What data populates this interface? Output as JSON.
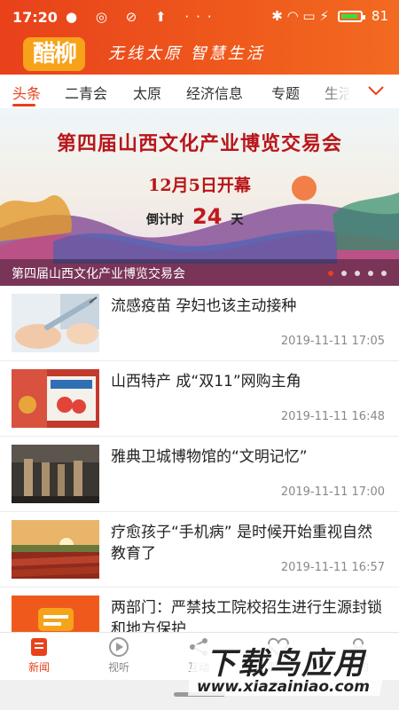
{
  "status_bar": {
    "time": "17:20",
    "left_icons": "● ◎ ⊘ ⬆ ···",
    "right_icons": "✱ ◠ ▭ ⚡",
    "battery": "81"
  },
  "header": {
    "logo": "醋柳",
    "slogan": "无线太原   智慧生活"
  },
  "tabs": [
    {
      "label": "头条",
      "active": true
    },
    {
      "label": "二青会"
    },
    {
      "label": "太原"
    },
    {
      "label": "经济信息"
    },
    {
      "label": "专题"
    },
    {
      "label": "生活"
    }
  ],
  "banner": {
    "title": "第四届山西文化产业博览交易会",
    "date": "12月5日开幕",
    "countdown_prefix": "倒计时",
    "countdown_value": "24",
    "countdown_unit": "天",
    "caption": "第四届山西文化产业博览交易会",
    "slide_count": 5,
    "active_slide": 1
  },
  "news": [
    {
      "title": "流感疫苗 孕妇也该主动接种",
      "time": "2019-11-11 17:05",
      "thumb": "vaccine-photo"
    },
    {
      "title": "山西特产 成“双11”网购主角",
      "time": "2019-11-11 16:48",
      "thumb": "specialty-box-photo"
    },
    {
      "title": "雅典卫城博物馆的“文明记忆”",
      "time": "2019-11-11 17:00",
      "thumb": "museum-statues-photo"
    },
    {
      "title": "疗愈孩子“手机病” 是时候开始重视自然教育了",
      "time": "2019-11-11 16:57",
      "thumb": "sunset-field-photo"
    },
    {
      "title": "两部门：严禁技工院校招生进行生源封锁和地方保护",
      "time": "",
      "thumb": "app-logo-thumb"
    }
  ],
  "bottom_nav": [
    {
      "label": "新闻",
      "icon": "news-icon",
      "active": true
    },
    {
      "label": "视听",
      "icon": "play-icon"
    },
    {
      "label": "互动",
      "icon": "share-icon"
    },
    {
      "label": "服务",
      "icon": "heart-icon"
    },
    {
      "label": "我的",
      "icon": "user-icon"
    }
  ],
  "watermark": {
    "title": "下载鸟应用",
    "url": "www.xiazainiao.com"
  },
  "colors": {
    "brand": "#e8411b",
    "logo_bg": "#f7a21b",
    "banner_title": "#b8161a"
  }
}
